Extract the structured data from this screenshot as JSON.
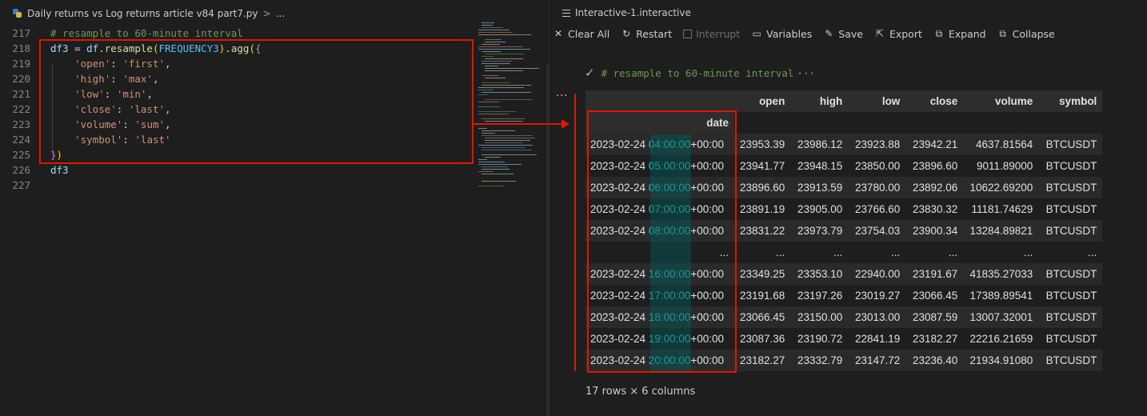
{
  "editor": {
    "breadcrumb": {
      "file_name": "Daily returns vs Log returns article v84 part7.py",
      "separator": ">",
      "ellipsis": "..."
    },
    "lines": [
      {
        "num": "217",
        "tokens": [
          {
            "c": "t-comment",
            "t": "# resample to 60-minute interval"
          }
        ]
      },
      {
        "num": "218",
        "tokens": [
          {
            "c": "t-var",
            "t": "df3"
          },
          {
            "c": "t-plain",
            "t": " = "
          },
          {
            "c": "t-var",
            "t": "df"
          },
          {
            "c": "t-plain",
            "t": "."
          },
          {
            "c": "t-fn",
            "t": "resample"
          },
          {
            "c": "t-br1",
            "t": "("
          },
          {
            "c": "t-const",
            "t": "FREQUENCY3"
          },
          {
            "c": "t-br1",
            "t": ")"
          },
          {
            "c": "t-plain",
            "t": "."
          },
          {
            "c": "t-fn",
            "t": "agg"
          },
          {
            "c": "t-br1",
            "t": "("
          },
          {
            "c": "t-br2",
            "t": "{"
          }
        ]
      },
      {
        "num": "219",
        "tokens": [
          {
            "c": "t-plain",
            "t": "    "
          },
          {
            "c": "t-str",
            "t": "'open'"
          },
          {
            "c": "t-plain",
            "t": ": "
          },
          {
            "c": "t-str",
            "t": "'first'"
          },
          {
            "c": "t-plain",
            "t": ","
          }
        ]
      },
      {
        "num": "220",
        "tokens": [
          {
            "c": "t-plain",
            "t": "    "
          },
          {
            "c": "t-str",
            "t": "'high'"
          },
          {
            "c": "t-plain",
            "t": ": "
          },
          {
            "c": "t-str",
            "t": "'max'"
          },
          {
            "c": "t-plain",
            "t": ","
          }
        ]
      },
      {
        "num": "221",
        "tokens": [
          {
            "c": "t-plain",
            "t": "    "
          },
          {
            "c": "t-str",
            "t": "'low'"
          },
          {
            "c": "t-plain",
            "t": ": "
          },
          {
            "c": "t-str",
            "t": "'min'"
          },
          {
            "c": "t-plain",
            "t": ","
          }
        ]
      },
      {
        "num": "222",
        "tokens": [
          {
            "c": "t-plain",
            "t": "    "
          },
          {
            "c": "t-str",
            "t": "'close'"
          },
          {
            "c": "t-plain",
            "t": ": "
          },
          {
            "c": "t-str",
            "t": "'last'"
          },
          {
            "c": "t-plain",
            "t": ","
          }
        ]
      },
      {
        "num": "223",
        "tokens": [
          {
            "c": "t-plain",
            "t": "    "
          },
          {
            "c": "t-str",
            "t": "'volume'"
          },
          {
            "c": "t-plain",
            "t": ": "
          },
          {
            "c": "t-str",
            "t": "'sum'"
          },
          {
            "c": "t-plain",
            "t": ","
          }
        ]
      },
      {
        "num": "224",
        "tokens": [
          {
            "c": "t-plain",
            "t": "    "
          },
          {
            "c": "t-str",
            "t": "'symbol'"
          },
          {
            "c": "t-plain",
            "t": ": "
          },
          {
            "c": "t-str",
            "t": "'last'"
          }
        ]
      },
      {
        "num": "225",
        "tokens": [
          {
            "c": "t-br2",
            "t": "}"
          },
          {
            "c": "t-br1",
            "t": ")"
          }
        ]
      },
      {
        "num": "226",
        "tokens": [
          {
            "c": "t-var",
            "t": "df3"
          }
        ]
      },
      {
        "num": "227",
        "tokens": []
      }
    ]
  },
  "interactive": {
    "tab_title": "Interactive-1.interactive",
    "toolbar": [
      {
        "id": "clear-all",
        "icon": "close-icon",
        "glyph": "✕",
        "label": "Clear All",
        "disabled": false
      },
      {
        "id": "restart",
        "icon": "restart-icon",
        "glyph": "↻",
        "label": "Restart",
        "disabled": false
      },
      {
        "id": "interrupt",
        "icon": "interrupt-icon",
        "glyph": "",
        "label": "Interrupt",
        "disabled": true
      },
      {
        "id": "variables",
        "icon": "variables-icon",
        "glyph": "▭",
        "label": "Variables",
        "disabled": false
      },
      {
        "id": "save",
        "icon": "save-icon",
        "glyph": "✎",
        "label": "Save",
        "disabled": false
      },
      {
        "id": "export",
        "icon": "export-icon",
        "glyph": "⇱",
        "label": "Export",
        "disabled": false
      },
      {
        "id": "expand",
        "icon": "expand-icon",
        "glyph": "⧉",
        "label": "Expand",
        "disabled": false
      },
      {
        "id": "collapse",
        "icon": "collapse-icon",
        "glyph": "⧉",
        "label": "Collapse",
        "disabled": false
      }
    ],
    "cell": {
      "status_icon": "check-icon",
      "status_glyph": "✓",
      "header_text": "# resample to 60-minute interval",
      "more": "···"
    },
    "output_more": "···",
    "table": {
      "columns": [
        "open",
        "high",
        "low",
        "close",
        "volume",
        "symbol"
      ],
      "index_name": "date",
      "rows": [
        {
          "date": "2023-02-24",
          "time": "04:00:00",
          "tz": "+00:00",
          "values": [
            "23953.39",
            "23986.12",
            "23923.88",
            "23942.21",
            "4637.81564",
            "BTCUSDT"
          ]
        },
        {
          "date": "2023-02-24",
          "time": "05:00:00",
          "tz": "+00:00",
          "values": [
            "23941.77",
            "23948.15",
            "23850.00",
            "23896.60",
            "9011.89000",
            "BTCUSDT"
          ]
        },
        {
          "date": "2023-02-24",
          "time": "06:00:00",
          "tz": "+00:00",
          "values": [
            "23896.60",
            "23913.59",
            "23780.00",
            "23892.06",
            "10622.69200",
            "BTCUSDT"
          ]
        },
        {
          "date": "2023-02-24",
          "time": "07:00:00",
          "tz": "+00:00",
          "values": [
            "23891.19",
            "23905.00",
            "23766.60",
            "23830.32",
            "11181.74629",
            "BTCUSDT"
          ]
        },
        {
          "date": "2023-02-24",
          "time": "08:00:00",
          "tz": "+00:00",
          "values": [
            "23831.22",
            "23973.79",
            "23754.03",
            "23900.34",
            "13284.89821",
            "BTCUSDT"
          ]
        },
        {
          "ellipsis": true,
          "index": "...",
          "values": [
            "...",
            "...",
            "...",
            "...",
            "...",
            "..."
          ]
        },
        {
          "date": "2023-02-24",
          "time": "16:00:00",
          "tz": "+00:00",
          "values": [
            "23349.25",
            "23353.10",
            "22940.00",
            "23191.67",
            "41835.27033",
            "BTCUSDT"
          ]
        },
        {
          "date": "2023-02-24",
          "time": "17:00:00",
          "tz": "+00:00",
          "values": [
            "23191.68",
            "23197.26",
            "23019.27",
            "23066.45",
            "17389.89541",
            "BTCUSDT"
          ]
        },
        {
          "date": "2023-02-24",
          "time": "18:00:00",
          "tz": "+00:00",
          "values": [
            "23066.45",
            "23150.00",
            "23013.00",
            "23087.59",
            "13007.32001",
            "BTCUSDT"
          ]
        },
        {
          "date": "2023-02-24",
          "time": "19:00:00",
          "tz": "+00:00",
          "values": [
            "23087.36",
            "23190.72",
            "22841.19",
            "23182.27",
            "22216.21659",
            "BTCUSDT"
          ]
        },
        {
          "date": "2023-02-24",
          "time": "20:00:00",
          "tz": "+00:00",
          "values": [
            "23182.27",
            "23332.79",
            "23147.72",
            "23236.40",
            "21934.91080",
            "BTCUSDT"
          ]
        }
      ],
      "shape_text": "17 rows × 6 columns"
    }
  },
  "colors": {
    "annotation_red": "#e51400",
    "time_highlight": "#32c8c8",
    "check_green": "#89d185"
  }
}
